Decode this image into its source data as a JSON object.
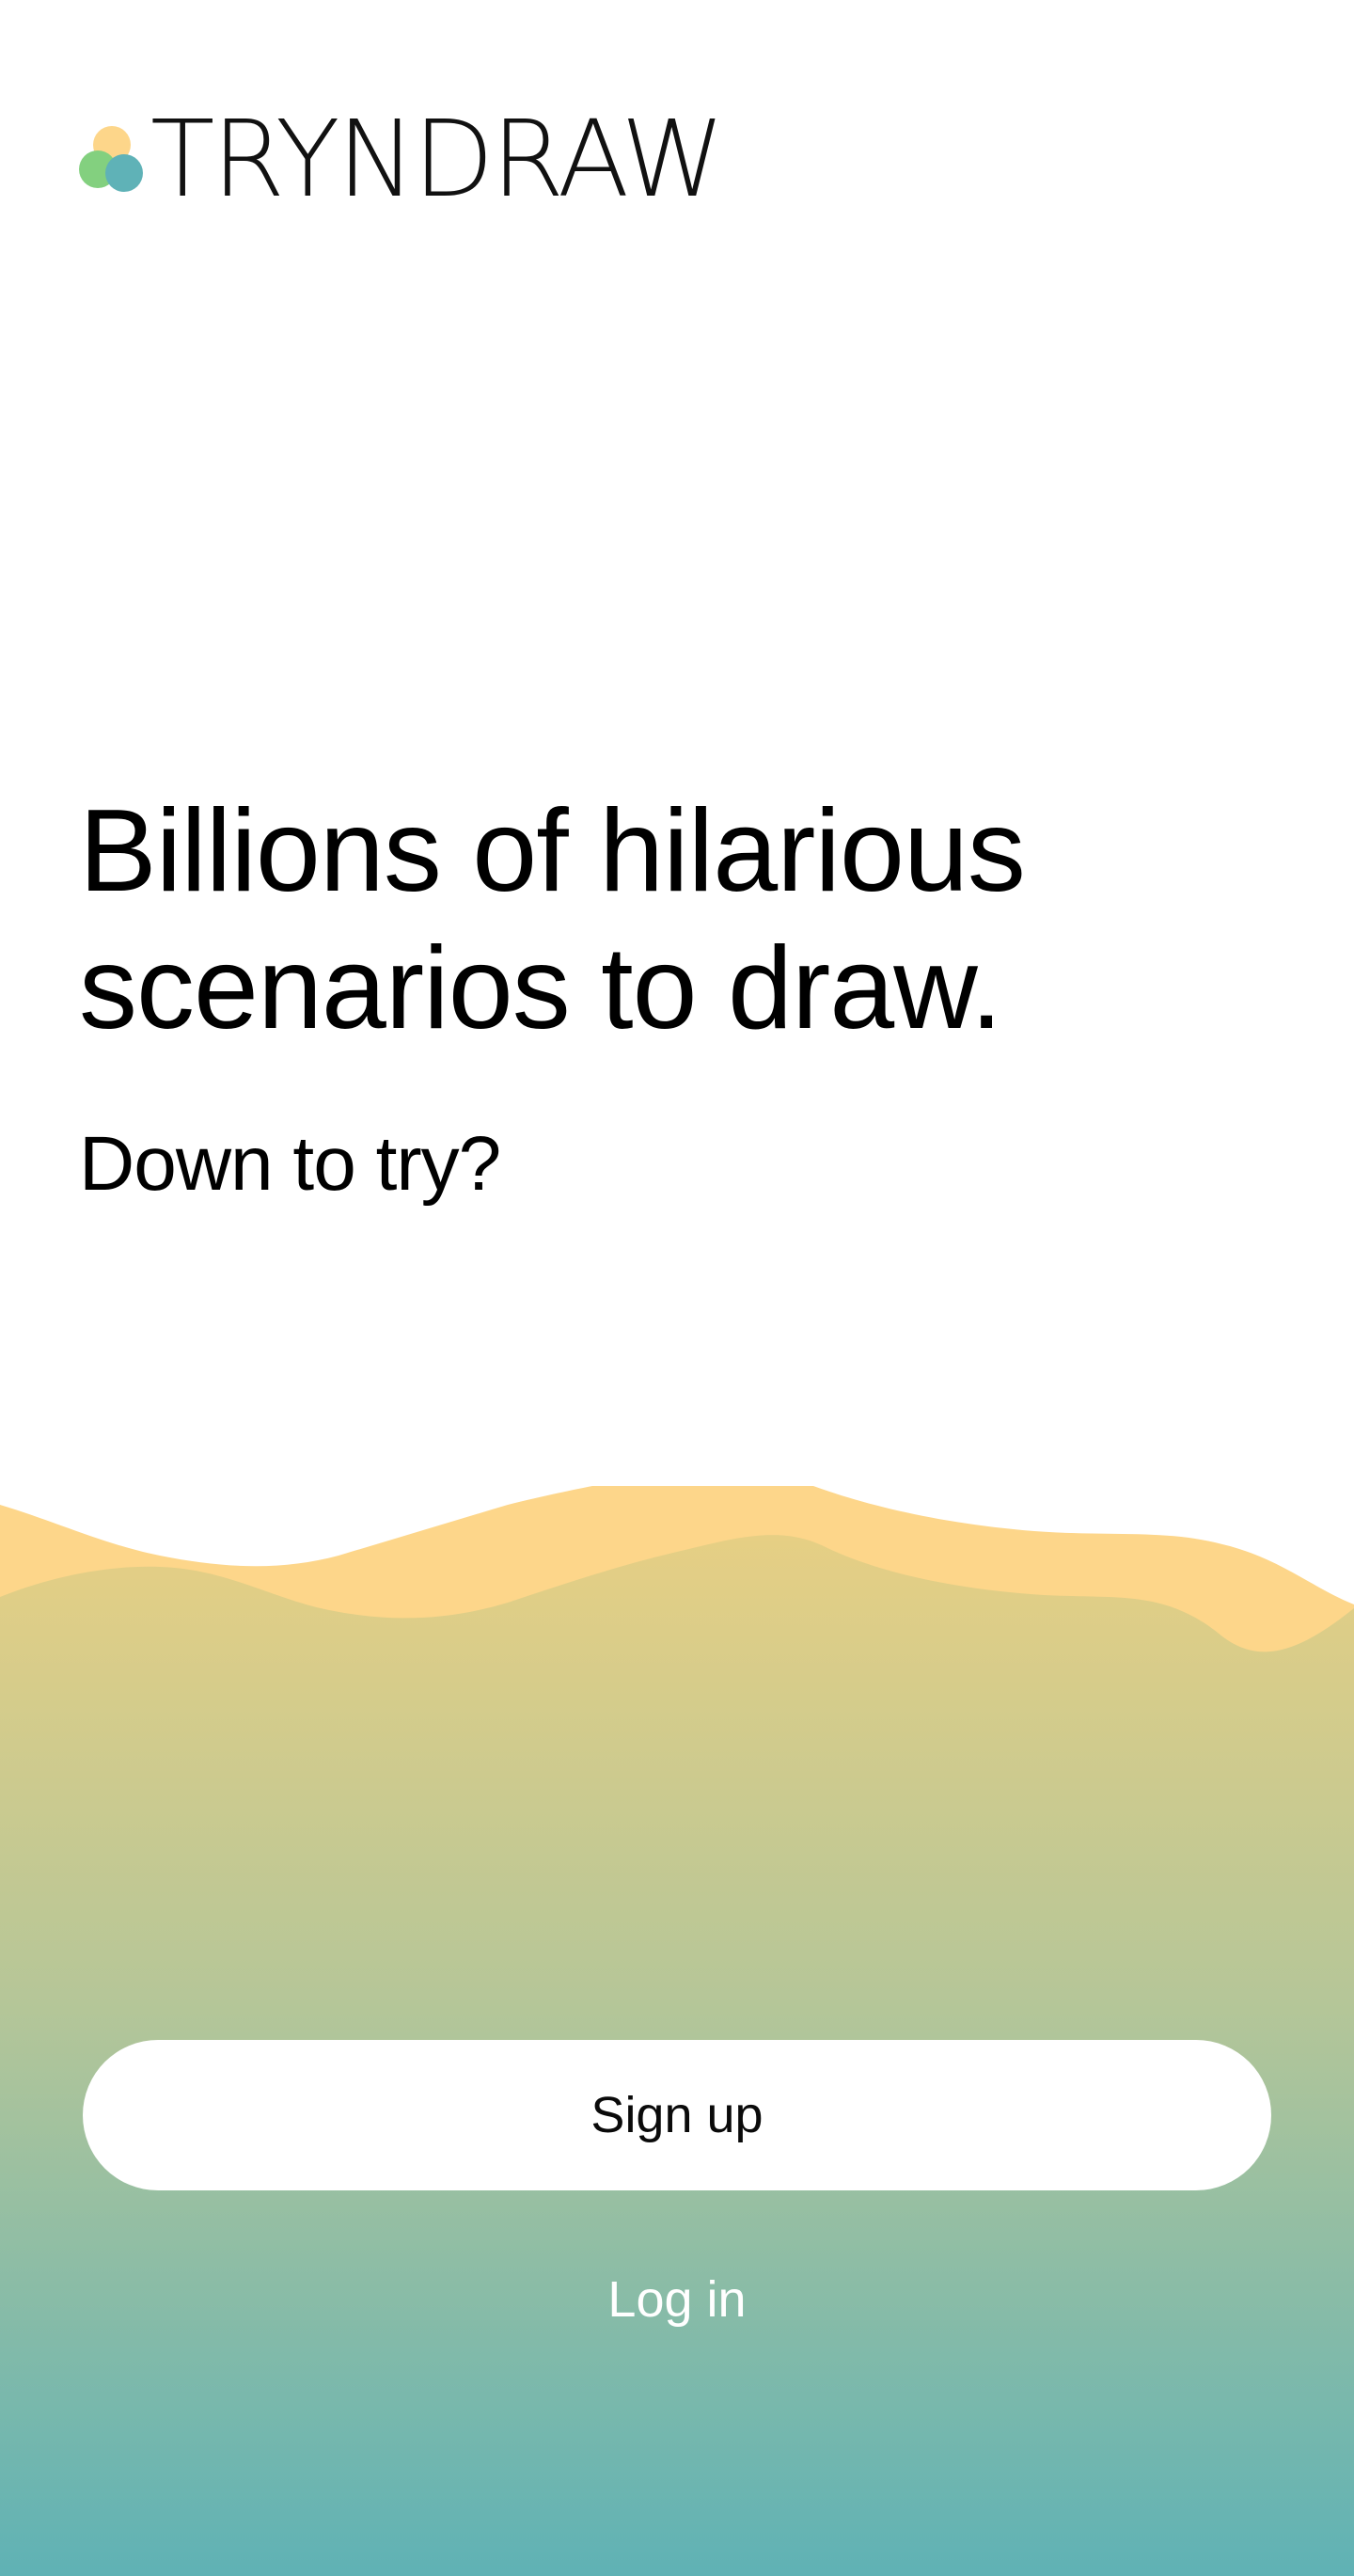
{
  "brand": {
    "name": "TRYNDRAW",
    "logo_colors": [
      "#fdd68a",
      "#83d07f",
      "#5fb2b7"
    ]
  },
  "hero": {
    "headline_line1": "Billions of hilarious",
    "headline_line2": "scenarios to draw.",
    "subheadline": "Down to try?"
  },
  "actions": {
    "signup_label": "Sign up",
    "login_label": "Log in"
  },
  "theme": {
    "wave_back_color": "#fdd68a",
    "gradient_top": "#e6cf84",
    "gradient_mid": "#b5c698",
    "gradient_bottom": "#5fb2b5",
    "button_color": "#ffffff"
  }
}
